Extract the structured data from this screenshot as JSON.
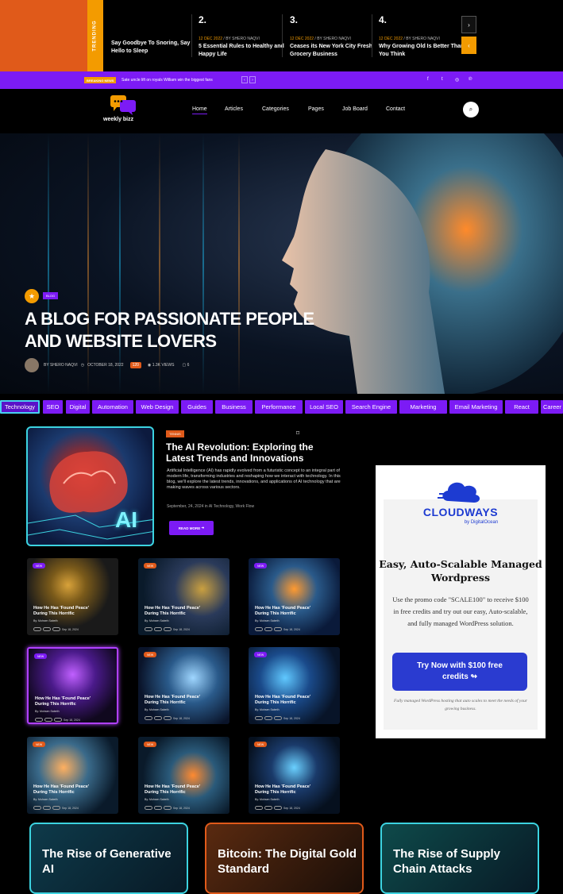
{
  "trending": {
    "label": "TRENDING",
    "first_title": "Say Goodbye To Snoring, Say Hello to Sleep",
    "items": [
      {
        "num": "2.",
        "date": "12 DEC 2022",
        "author": "BY SHERO NAQVI",
        "title": "5 Essential Rules to Healthy and Happy Life"
      },
      {
        "num": "3.",
        "date": "12 DEC 2022",
        "author": "BY SHERO NAQVI",
        "title": "Ceases its New York City Fresh Grocery Business"
      },
      {
        "num": "4.",
        "date": "12 DEC 2022",
        "author": "BY SHERO NAQVI",
        "title": "Why Growing Old Is Better Than You Think"
      }
    ],
    "prev_icon": "›",
    "next_icon": "‹"
  },
  "breaking": {
    "label": "BREAKING NEWS",
    "text": "Sate uncle lift on royals William win the biggest fans",
    "prev": "‹",
    "next": "›",
    "social": [
      "f",
      "t",
      "◎",
      "℗"
    ]
  },
  "header": {
    "logo_text": "weekly bizz",
    "menu": [
      "Home",
      "Articles",
      "Categories",
      "Pages",
      "Job Board",
      "Contact"
    ],
    "search_icon": "⌕"
  },
  "hero": {
    "tag": "BLOG",
    "title": "A BLOG FOR PASSIONATE PEOPLE AND WEBSITE LOVERS",
    "author": "BY SHERO NAQVI",
    "date": "OCTOBER 18, 2022",
    "likes": "120",
    "views": "1.3K VIEWS",
    "comments": "6"
  },
  "tags": [
    "Technology",
    "SEO",
    "Digital",
    "Automation",
    "Web Design",
    "Guides",
    "Business",
    "Performance",
    "Local SEO",
    "Search Engine",
    "Marketing",
    "Email Marketing",
    "React",
    "Career"
  ],
  "feature": {
    "tag": "TENNIS",
    "title": "The AI Revolution: Exploring the Latest Trends and Innovations",
    "desc": "Artificial Intelligence (AI) has rapidly evolved from a futuristic concept to an integral part of modern life, transforming industries and reshaping how we interact with technology. In this blog, we'll explore the latest trends, innovations, and applications of AI technology that are making waves across various sectors.",
    "meta": "September, 24, 2024 in AI Technology, Work Flow",
    "read_more": "READ MORE",
    "img_label": "AI"
  },
  "cards": [
    {
      "badge": "NEW",
      "title": "How He Has 'Found Peace' During This Horrific",
      "by": "By: Mohsen Sabeth",
      "date": "Sep 18, 2024"
    },
    {
      "badge": "NEW",
      "title": "How He Has 'Found Peace' During This Horrific",
      "by": "By: Mohsen Sabeth",
      "date": "Sep 18, 2024"
    },
    {
      "badge": "NEW",
      "title": "How He Has 'Found Peace' During This Horrific",
      "by": "By: Mohsen Sabeth",
      "date": "Sep 18, 2024"
    },
    {
      "badge": "NEW",
      "title": "How He Has 'Found Peace' During This Horrific",
      "by": "By: Mohsen Sabeth",
      "date": "Sep 18, 2024"
    },
    {
      "badge": "NEW",
      "title": "How He Has 'Found Peace' During This Horrific",
      "by": "By: Mohsen Sabeth",
      "date": "Sep 18, 2024"
    },
    {
      "badge": "NEW",
      "title": "How He Has 'Found Peace' During This Horrific",
      "by": "By: Mohsen Sabeth",
      "date": "Sep 18, 2024"
    },
    {
      "badge": "NEW",
      "title": "How He Has 'Found Peace' During This Horrific",
      "by": "By: Mohsen Sabeth",
      "date": "Sep 18, 2024"
    },
    {
      "badge": "NEW",
      "title": "How He Has 'Found Peace' During This Horrific",
      "by": "By: Mohsen Sabeth",
      "date": "Sep 18, 2024"
    },
    {
      "badge": "NEW",
      "title": "How He Has 'Found Peace' During This Horrific",
      "by": "By: Mohsen Sabeth",
      "date": "Sep 18, 2024"
    }
  ],
  "ad": {
    "brand": "CLOUDWAYS",
    "by": "by DigitalOcean",
    "headline": "Easy, Auto-Scalable Managed Wordpress",
    "body": "Use the promo code \"SCALE100\" to receive $100 in free credits and try out our easy, Auto-scalable, and fully managed WordPress solution.",
    "cta": "Try Now with $100 free credits ↬",
    "footnote": "Fully managed WordPress hosting that auto scales to meet the needs of your growing business."
  },
  "bottom_cards": [
    {
      "title": "The Rise of Generative AI"
    },
    {
      "title": "Bitcoin: The Digital Gold Standard"
    },
    {
      "title": "The Rise of Supply Chain Attacks"
    }
  ],
  "colors": {
    "accent": "#7c1bf5",
    "orange": "#f39b00",
    "cyan": "#3cd3e0",
    "brand_blue": "#1d3bd1"
  }
}
